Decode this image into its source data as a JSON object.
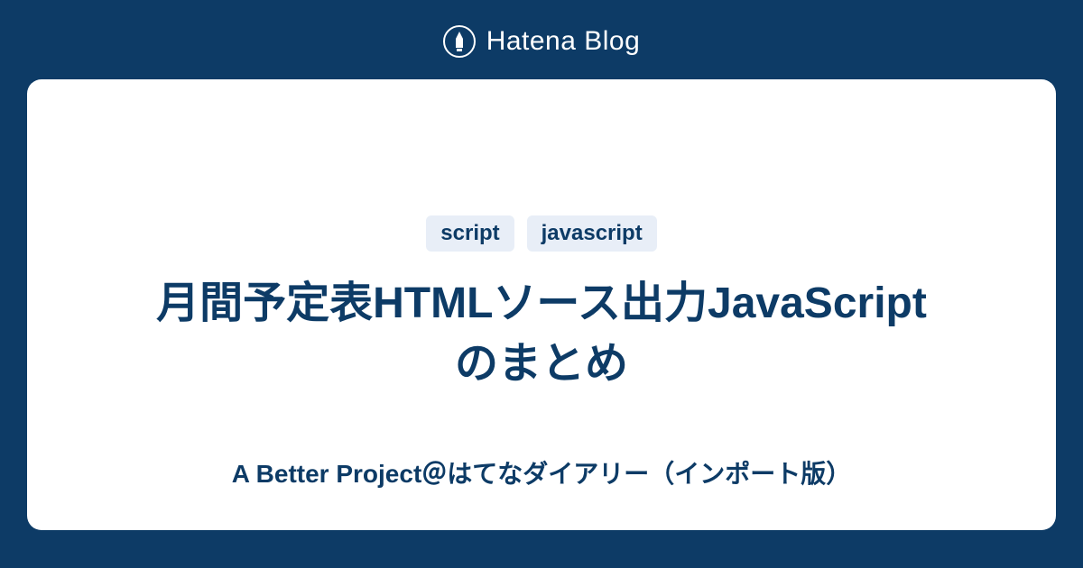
{
  "header": {
    "brand": "Hatena Blog"
  },
  "card": {
    "tags": [
      "script",
      "javascript"
    ],
    "title": "月間予定表HTMLソース出力JavaScriptのまとめ",
    "subtitle": "A Better Project＠はてなダイアリー（インポート版）"
  }
}
